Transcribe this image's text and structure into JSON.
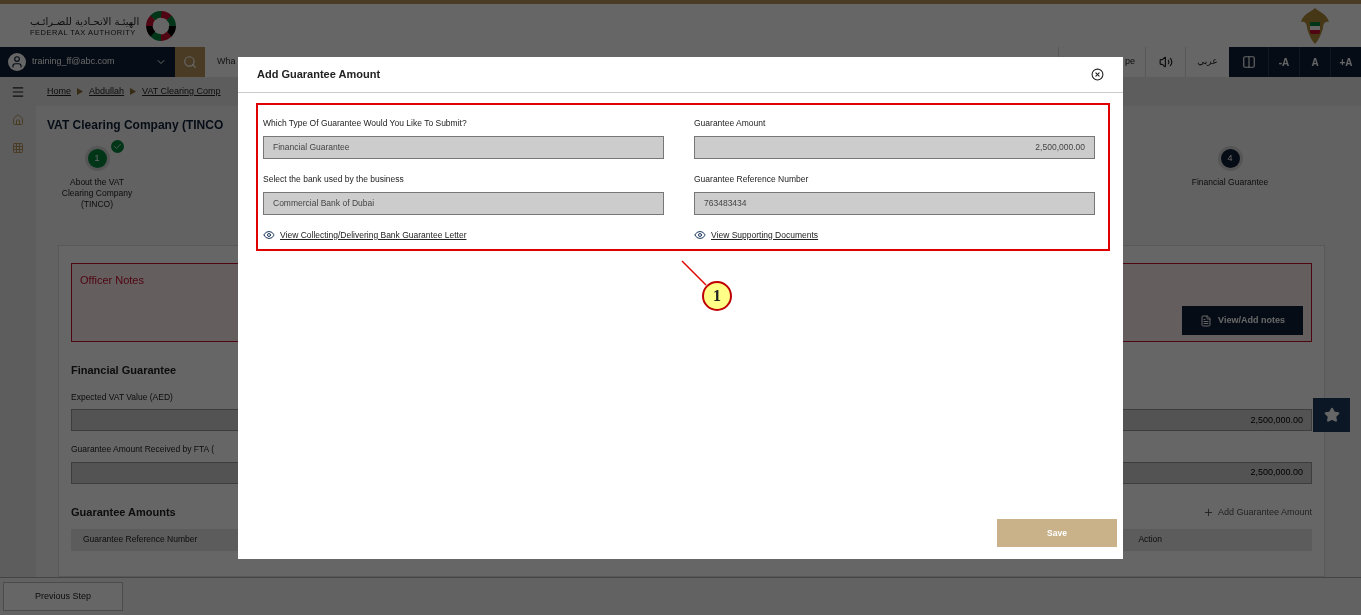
{
  "header": {
    "logo_arabic": "الهيئـة الاتحـادية للضـرائـب",
    "logo_english": "FEDERAL TAX AUTHORITY"
  },
  "navbar": {
    "user_email": "training_ff@abc.com",
    "search_placeholder": "Wha",
    "partial_button": "pe",
    "language": "عربي",
    "font_buttons": [
      "-A",
      "A",
      "+A"
    ]
  },
  "breadcrumbs": [
    "Home",
    "Abdullah",
    "VAT Clearing Comp"
  ],
  "page_title": "VAT Clearing Company (TINCO",
  "steps": [
    {
      "number": "1",
      "label": "About the VAT Clearing Company (TINCO)",
      "completed": true
    },
    {
      "number": "4",
      "label": "Financial Guarantee",
      "completed": false
    }
  ],
  "officer_notes": {
    "title": "Officer Notes",
    "button": "View/Add notes"
  },
  "financial_guarantee": {
    "title": "Financial Guarantee",
    "fields": [
      {
        "label": "Expected VAT Value (AED)",
        "value": "2,500,000.00"
      },
      {
        "label": "Guarantee Amount Received by FTA (",
        "value": "2,500,000.00"
      }
    ]
  },
  "guarantee_amounts": {
    "title": "Guarantee Amounts",
    "add_button": "Add Guarantee Amount",
    "columns": [
      "Guarantee Reference Number",
      "Action"
    ]
  },
  "footer": {
    "previous_button": "Previous Step"
  },
  "modal": {
    "title": "Add Guarantee Amount",
    "fields": [
      {
        "label": "Which Type Of Guarantee Would You Like To Submit?",
        "value": "Financial Guarantee",
        "kind": "text"
      },
      {
        "label": "Guarantee Amount",
        "value": "2,500,000.00",
        "kind": "number"
      },
      {
        "label": "Select the bank used by the business",
        "value": "Commercial Bank of Dubai",
        "kind": "text"
      },
      {
        "label": "Guarantee Reference Number",
        "value": "763483434",
        "kind": "text"
      }
    ],
    "links": [
      "View Collecting/Delivering Bank Guarantee Letter",
      "View Supporting Documents"
    ],
    "save_button": {
      "label": "Save",
      "disabled": true
    }
  },
  "annotation": {
    "number": "1"
  }
}
